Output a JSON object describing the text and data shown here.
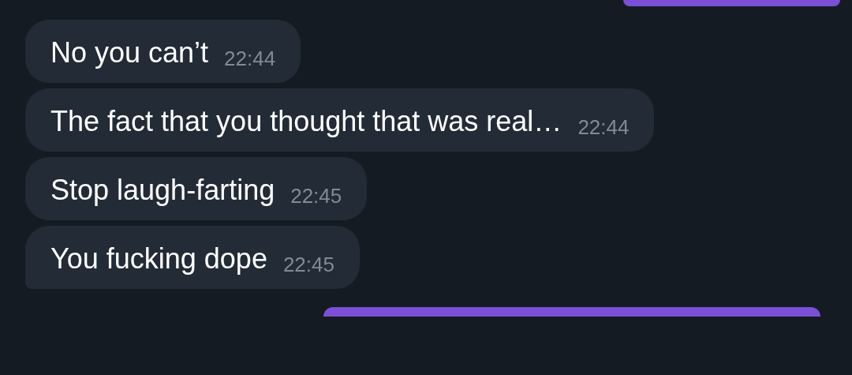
{
  "messages": [
    {
      "kind": "outgoing"
    },
    {
      "kind": "incoming",
      "text": "No you can’t",
      "time": "22:44"
    },
    {
      "kind": "incoming",
      "text": "The fact that you thought that was real…",
      "time": "22:44"
    },
    {
      "kind": "incoming",
      "text": "Stop laugh-farting",
      "time": "22:45"
    },
    {
      "kind": "incoming",
      "text": "You fucking dope",
      "time": "22:45"
    },
    {
      "kind": "outgoing"
    }
  ]
}
